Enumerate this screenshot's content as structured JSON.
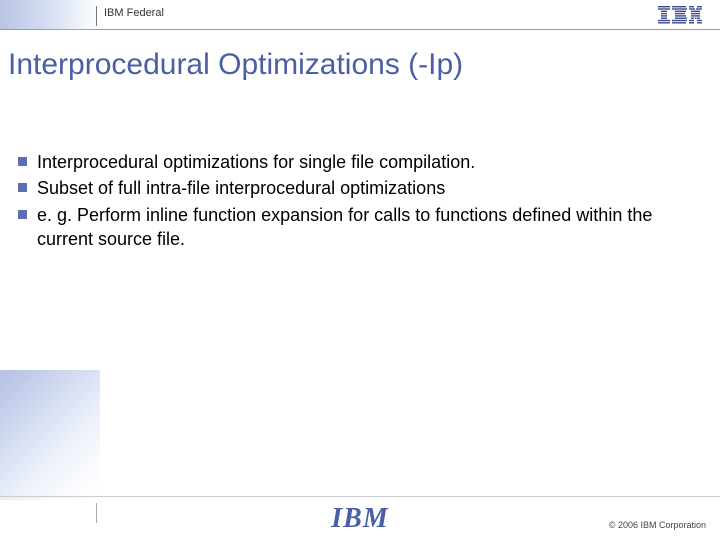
{
  "header": {
    "label": "IBM Federal",
    "logo_alt": "IBM"
  },
  "title": "Interprocedural Optimizations (-Ip)",
  "bullets": [
    "Interprocedural optimizations for single file compilation.",
    "Subset of full intra-file interprocedural optimizations",
    "e. g. Perform inline function expansion for calls to functions defined within the current source file."
  ],
  "footer": {
    "logo_text": "IBM",
    "copyright": "© 2006 IBM Corporation"
  }
}
